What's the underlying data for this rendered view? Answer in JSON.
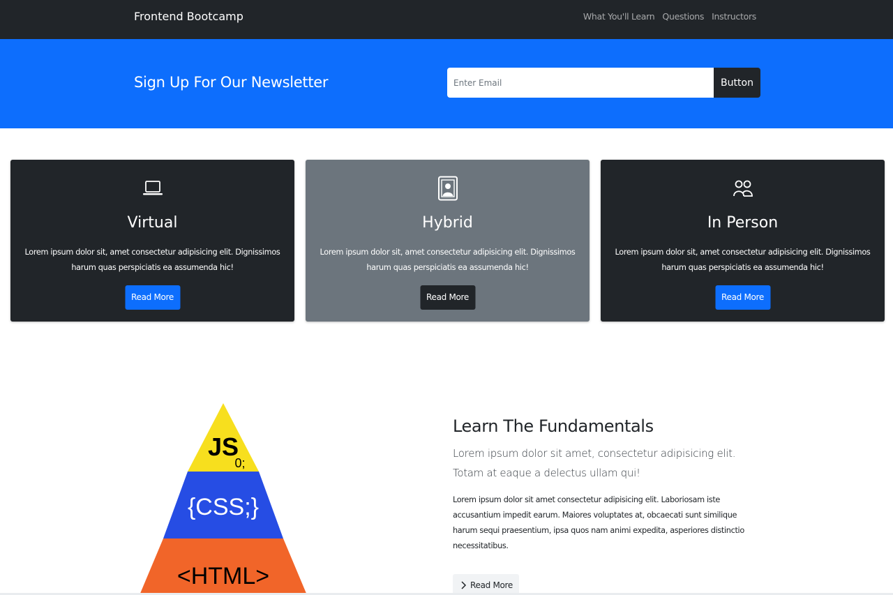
{
  "navbar": {
    "brand": "Frontend Bootcamp",
    "links": [
      "What You'll Learn",
      "Questions",
      "Instructors"
    ]
  },
  "newsletter": {
    "title": "Sign Up For Our Newsletter",
    "email_placeholder": "Enter Email",
    "button_label": "Button"
  },
  "cards": [
    {
      "icon": "laptop-icon",
      "title": "Virtual",
      "text": "Lorem ipsum dolor sit, amet consectetur adipisicing elit. Dignissimos harum quas perspiciatis ea assumenda hic!",
      "button_label": "Read More"
    },
    {
      "icon": "person-badge-icon",
      "title": "Hybrid",
      "text": "Lorem ipsum dolor sit, amet consectetur adipisicing elit. Dignissimos harum quas perspiciatis ea assumenda hic!",
      "button_label": "Read More"
    },
    {
      "icon": "people-icon",
      "title": "In Person",
      "text": "Lorem ipsum dolor sit, amet consectetur adipisicing elit. Dignissimos harum quas perspiciatis ea assumenda hic!",
      "button_label": "Read More"
    }
  ],
  "learn": {
    "pyramid_labels": [
      "JS",
      "0;",
      "{CSS;}",
      "<HTML>"
    ],
    "title": "Learn The Fundamentals",
    "lead": "Lorem ipsum dolor sit amet, consectetur adipisicing elit. Totam at eaque a delectus ullam qui!",
    "body": "Lorem ipsum dolor sit amet consectetur adipisicing elit. Laboriosam iste accusantium impedit earum. Maiores voluptates at, obcaecati sunt similique harum sequi praesentium, ipsa quos nam animi expedita, asperiores distinctio necessitatibus.",
    "read_more_label": "Read More"
  },
  "colors": {
    "dark": "#212529",
    "primary": "#0d6efd",
    "secondary": "#6c757d",
    "js_yellow": "#f7df1e",
    "css_blue": "#264de4",
    "html_orange": "#f16529"
  }
}
